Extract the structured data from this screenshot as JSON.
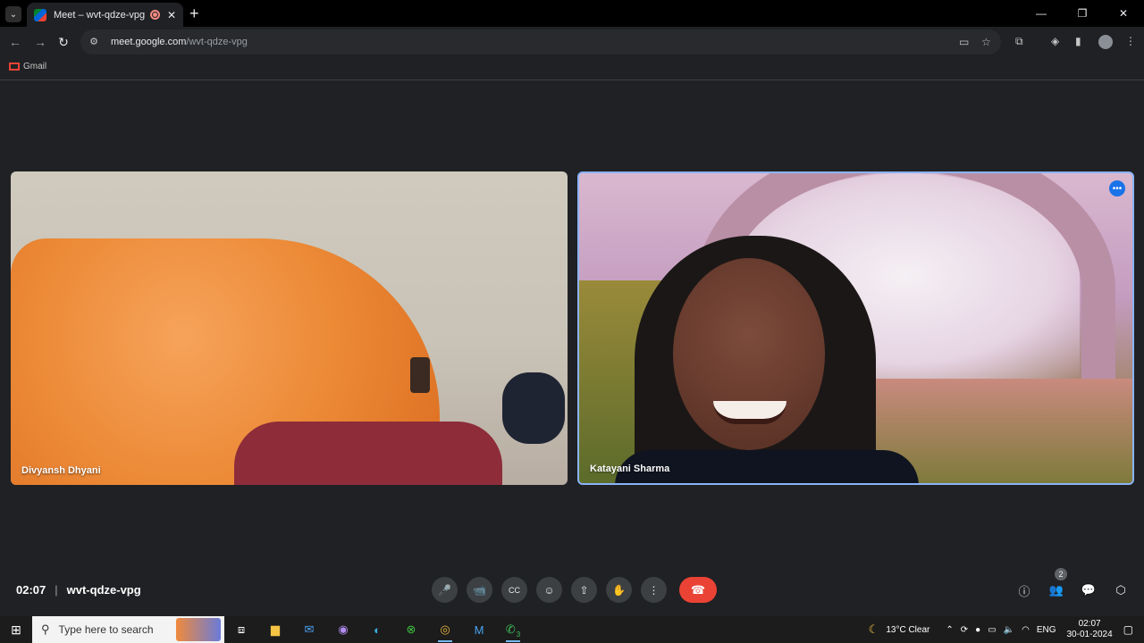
{
  "browser": {
    "tab_title": "Meet – wvt-qdze-vpg",
    "tab_close": "✕",
    "new_tab": "+",
    "url_host": "meet.google.com",
    "url_path": "/wvt-qdze-vpg",
    "bookmark_gmail": "Gmail",
    "win_minimize": "—",
    "win_restore": "❐",
    "win_close": "✕"
  },
  "meeting": {
    "time": "02:07",
    "separator": "|",
    "code": "wvt-qdze-vpg",
    "participants_count": "2",
    "tiles": [
      {
        "name": "Divyansh Dhyani"
      },
      {
        "name": "Katayani Sharma",
        "active_speaker": true
      }
    ]
  },
  "controls": {
    "mic": "🎤",
    "camera": "📹",
    "captions": "CC",
    "emoji": "☺",
    "present": "⇧",
    "raise_hand": "✋",
    "more": "⋮",
    "leave": "☎",
    "info": "ⓘ",
    "people": "👥",
    "chat": "💬",
    "activities": "⬡"
  },
  "taskbar": {
    "search_placeholder": "Type here to search",
    "weather": "13°C  Clear",
    "lang": "ENG",
    "clock_time": "02:07",
    "clock_date": "30-01-2024",
    "whatsapp_badge": "3"
  },
  "colors": {
    "accent": "#8ab4f8",
    "leave_red": "#ea4335",
    "background": "#202124"
  }
}
